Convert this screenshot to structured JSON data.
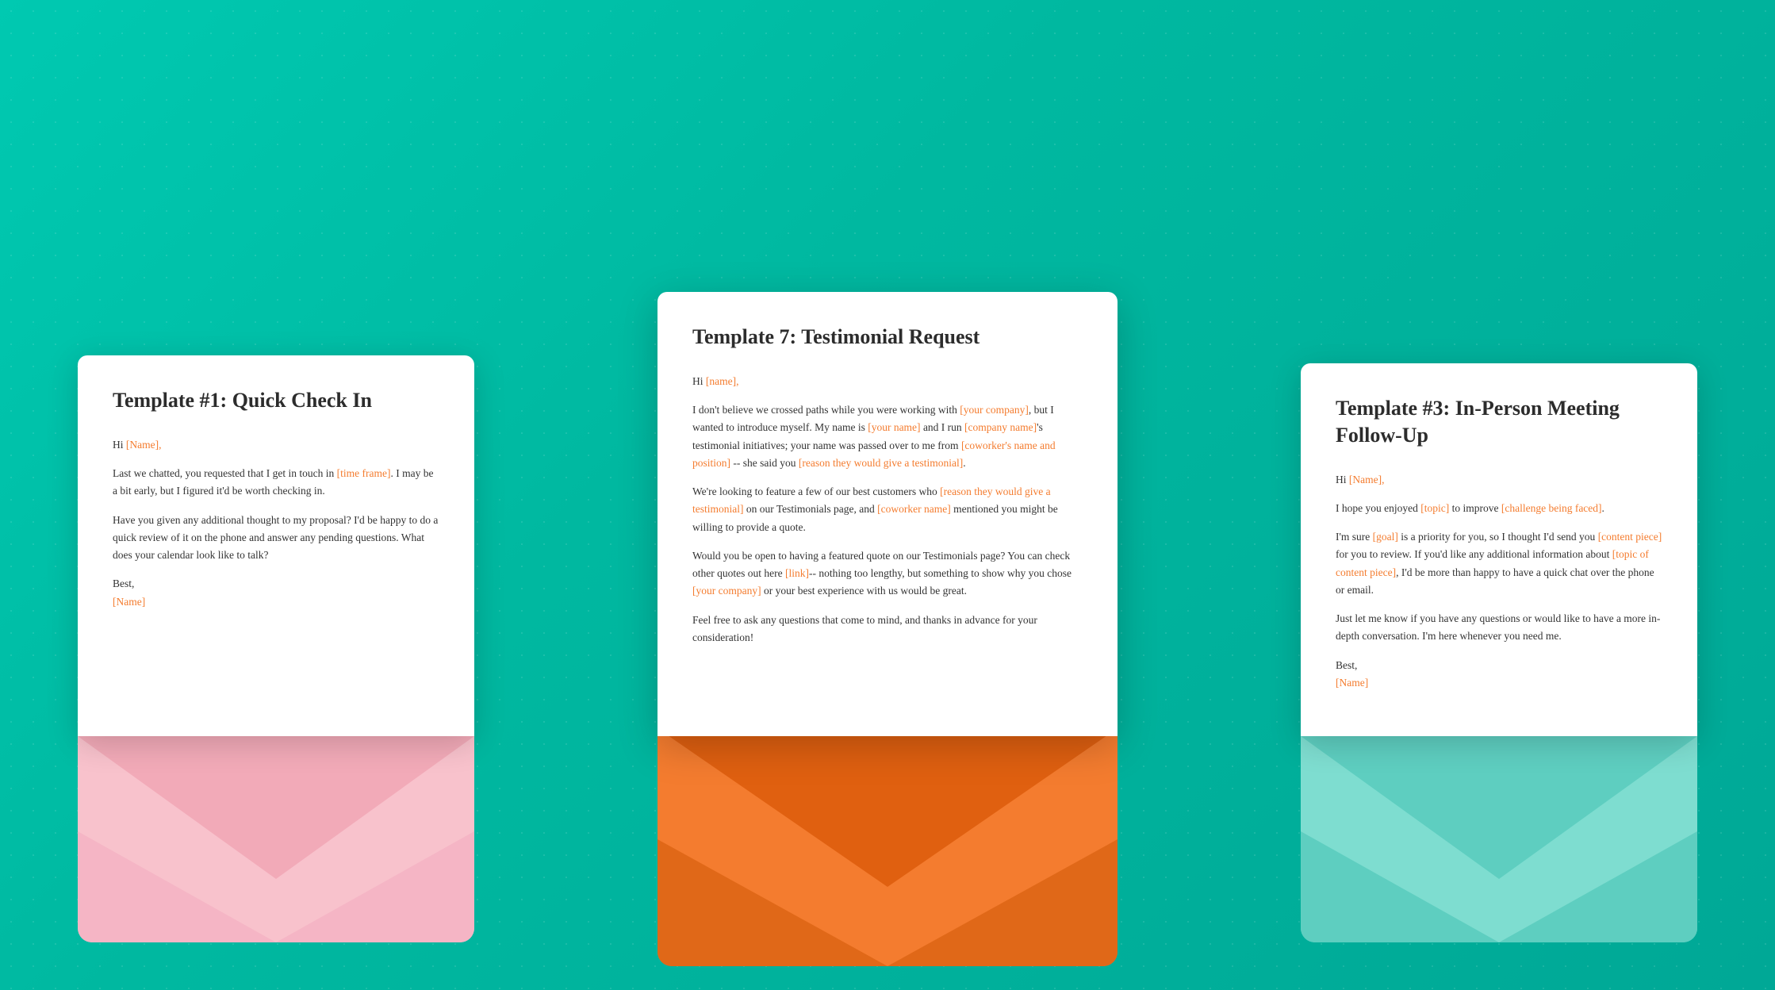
{
  "background": {
    "color": "#00b8a0"
  },
  "envelopes": {
    "left": {
      "title": "Template #1: Quick Check In",
      "greeting": "Hi ",
      "greeting_name": "[Name],",
      "body1": "Last we chatted, you requested that I get in touch in ",
      "body1_highlight": "[time frame]",
      "body1_cont": ". I may be a bit early, but I figured it'd be worth checking in.",
      "body2": "Have you given any additional thought to my proposal? I'd be happy to do a quick review of it on the phone and answer any pending questions. What does your calendar look like to talk?",
      "closing": "Best,",
      "closing_name": "[Name]",
      "env_color": "#f8c2cc"
    },
    "center": {
      "title": "Template 7: Testimonial Request",
      "greeting": "Hi ",
      "greeting_name": "[name],",
      "body1_pre": "I don't believe we crossed paths while you were working with ",
      "body1_h1": "[your company]",
      "body1_mid": ", but I wanted to introduce myself. My name is ",
      "body1_h2": "[your name]",
      "body1_cont": " and I run ",
      "body1_h3": "[company name]",
      "body1_cont2": "'s testimonial initiatives; your name was passed over to me from ",
      "body1_h4": "[coworker's name and position]",
      "body1_cont3": " -- she said you ",
      "body1_h5": "[reason they would give a testimonial]",
      "body1_end": ".",
      "body2_pre": "We're looking to feature a few of our best customers who ",
      "body2_h1": "[reason they would give a testimonial]",
      "body2_cont": " on our Testimonials page, and ",
      "body2_h2": "[coworker name]",
      "body2_end": " mentioned you might be willing to provide a quote.",
      "body3": "Would you be open to having a featured quote on our Testimonials page? You can check other quotes out here ",
      "body3_h1": "[link]",
      "body3_cont": "-- nothing too lengthy, but something to show why you chose ",
      "body3_h2": "[your company]",
      "body3_end": " or your best experience with us would be great.",
      "body4_pre": "Feel free to ask any questions that come to mind, and thanks in advance for your consideration!",
      "env_color": "#f47c2f"
    },
    "right": {
      "title": "Template #3: In-Person Meeting Follow-Up",
      "greeting": "Hi ",
      "greeting_name": "[Name],",
      "body1_pre": "I hope you enjoyed ",
      "body1_h1": "[topic]",
      "body1_cont": " to improve ",
      "body1_h2": "[challenge being faced]",
      "body1_end": ".",
      "body2_pre": "I'm sure ",
      "body2_h1": "[goal]",
      "body2_cont": " is a priority for you, so I thought I'd send you ",
      "body2_h2": "[content piece]",
      "body2_cont2": " for you to review. If you'd like any additional information about ",
      "body2_h3": "[topic of content piece]",
      "body2_end": ", I'd be more than happy to have a quick chat over the phone or email.",
      "body3": "Just let me know if you have any questions or would like to have a more in-depth conversation. I'm here whenever you need me.",
      "closing": "Best,",
      "closing_name": "[Name]",
      "env_color": "#7eddd0"
    }
  }
}
